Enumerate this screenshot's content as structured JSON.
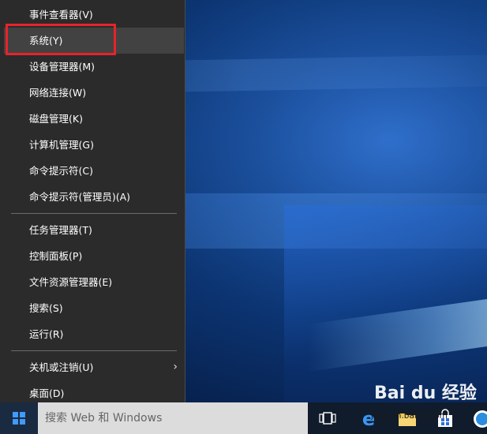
{
  "menu": {
    "items": [
      {
        "label": "事件查看器(V)"
      },
      {
        "label": "系统(Y)"
      },
      {
        "label": "设备管理器(M)"
      },
      {
        "label": "网络连接(W)"
      },
      {
        "label": "磁盘管理(K)"
      },
      {
        "label": "计算机管理(G)"
      },
      {
        "label": "命令提示符(C)"
      },
      {
        "label": "命令提示符(管理员)(A)"
      },
      {
        "label": "任务管理器(T)"
      },
      {
        "label": "控制面板(P)"
      },
      {
        "label": "文件资源管理器(E)"
      },
      {
        "label": "搜索(S)"
      },
      {
        "label": "运行(R)"
      },
      {
        "label": "关机或注销(U)"
      },
      {
        "label": "桌面(D)"
      }
    ],
    "submenu_indicator": "›"
  },
  "taskbar": {
    "search_placeholder": "搜索 Web 和 Windows",
    "start_icon": "windows-logo-icon",
    "pinned": [
      "task-view-icon",
      "edge-icon",
      "file-explorer-icon",
      "store-icon",
      "app-icon"
    ]
  },
  "watermark": {
    "brand": "Bai du 经验",
    "sub": "jingyan.baidu.com"
  },
  "colors": {
    "menu_bg": "#2b2b2b",
    "menu_hover": "#424242",
    "highlight": "#e8232a",
    "accent": "#3f9bff"
  }
}
